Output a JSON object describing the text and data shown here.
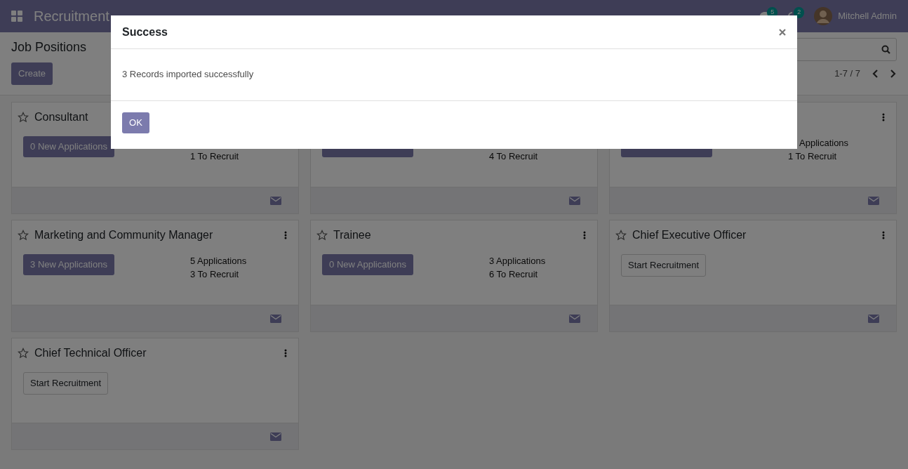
{
  "navbar": {
    "app": "Recruitment",
    "messages_count": "5",
    "activities_count": "2",
    "user": "Mitchell Admin"
  },
  "control_panel": {
    "title": "Job Positions",
    "create": "Create",
    "pager": "1-7 / 7"
  },
  "cards": [
    {
      "title": "Consultant",
      "starred": false,
      "kind": "applications",
      "button": "0 New Applications",
      "stats": [
        "1 To Recruit"
      ]
    },
    {
      "kind": "applications",
      "stats": [
        "4 To Recruit"
      ]
    },
    {
      "menu": true,
      "kind": "applications",
      "stats": [
        "Applications",
        "1 To Recruit"
      ]
    },
    {
      "title": "Marketing and Community Manager",
      "starred": false,
      "menu": true,
      "kind": "applications",
      "button": "3 New Applications",
      "stats": [
        "5 Applications",
        "3 To Recruit"
      ]
    },
    {
      "title": "Trainee",
      "starred": false,
      "menu": true,
      "kind": "applications",
      "button": "0 New Applications",
      "stats": [
        "3 Applications",
        "6 To Recruit"
      ]
    },
    {
      "title": "Chief Executive Officer",
      "starred": false,
      "menu": true,
      "kind": "start",
      "button": "Start Recruitment"
    },
    {
      "title": "Chief Technical Officer",
      "starred": false,
      "menu": true,
      "kind": "start",
      "button": "Start Recruitment"
    }
  ],
  "dialog": {
    "title": "Success",
    "message": "3 Records imported successfully",
    "ok": "OK"
  }
}
